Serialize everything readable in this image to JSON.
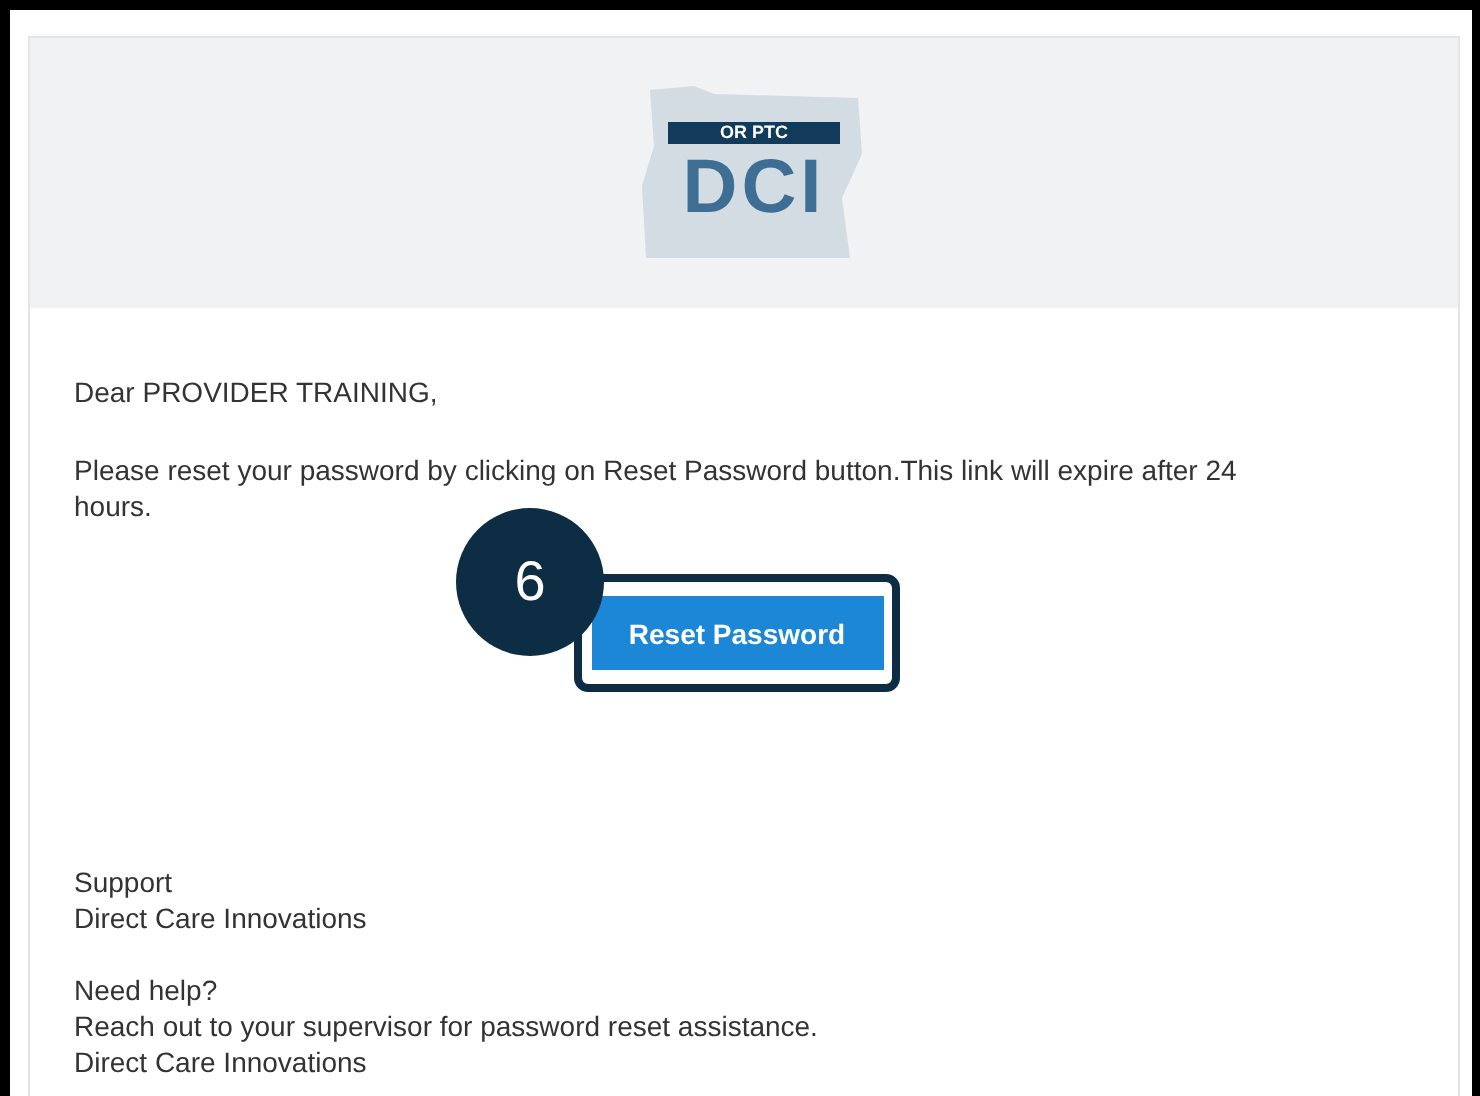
{
  "logo": {
    "banner": "OR PTC",
    "letters": "DCI"
  },
  "greeting": "Dear PROVIDER TRAINING,",
  "message": "Please reset your password by clicking on Reset Password button.This link will expire after 24 hours.",
  "callout": {
    "number": "6"
  },
  "button": {
    "label": "Reset Password"
  },
  "signature": [
    "Support",
    "Direct Care Innovations"
  ],
  "help": [
    "Need help?",
    "Reach out to your supervisor for password reset assistance.",
    "Direct Care Innovations"
  ]
}
